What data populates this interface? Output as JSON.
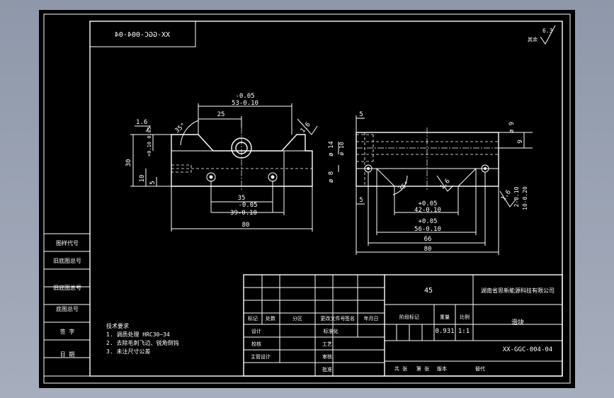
{
  "drawing": {
    "part_number_mirrored": "XX-GGC-004-04",
    "roughness_note": "其余",
    "roughness_value": "6.3",
    "front_view": {
      "dims": {
        "d53_tol": "-0.05",
        "d53": "53-0.10",
        "d25": "25",
        "d35": "35",
        "d39_tol": "-0.05",
        "d39": "39-0.10",
        "d80": "80",
        "d30": "30",
        "d10": "10",
        "d5": "5",
        "d10_tol": "+0.10\n0.05",
        "r16": "1.6",
        "ang35": "35°",
        "r16b": "1.6"
      }
    },
    "side_view": {
      "dims": {
        "d5_top": "5",
        "d14": "ø 14",
        "d10b": "ø 10",
        "d8": "ø 8",
        "d9": "ø 9",
        "d9b": "9",
        "d5_bot": "5",
        "d42_tol": "+0.05",
        "d42": "42-0.10",
        "d56_tol": "+0.05",
        "d56": "56-0.10",
        "d66": "66",
        "d80": "80",
        "d10r": "10-0.20",
        "d20": "2-0.10",
        "ang35": "35°",
        "r16": "1.6",
        "r16b": "1.6"
      }
    },
    "left_strip": [
      "图样代号",
      "旧底图总号",
      "旧底图总号",
      "底图总号",
      "签 字",
      "日 期"
    ],
    "tech_req": {
      "title": "技术要求",
      "items": [
        "1. 调质处理 HRC30~34",
        "2. 去除毛刺飞边、锐角倒钝",
        "3. 未注尺寸公差"
      ]
    },
    "title_block": {
      "material": "45",
      "company": "湖南省思新能源科技有限公司",
      "part_name": "滑块",
      "part_number": "XX-GGC-004-04",
      "weight": "0.931",
      "scale": "1:1",
      "headers": [
        "标记",
        "处数",
        "分区",
        "更改文件号",
        "签名",
        "年月日"
      ],
      "header_right": [
        "阶段标记",
        "重量",
        "比例"
      ],
      "rows": [
        "设计",
        "校核",
        "主管设计"
      ],
      "rows_mid": [
        "标准化",
        "工艺",
        "审核",
        "批准"
      ],
      "bottom": [
        "共 张",
        "第 张",
        "版本",
        "替代"
      ]
    }
  }
}
